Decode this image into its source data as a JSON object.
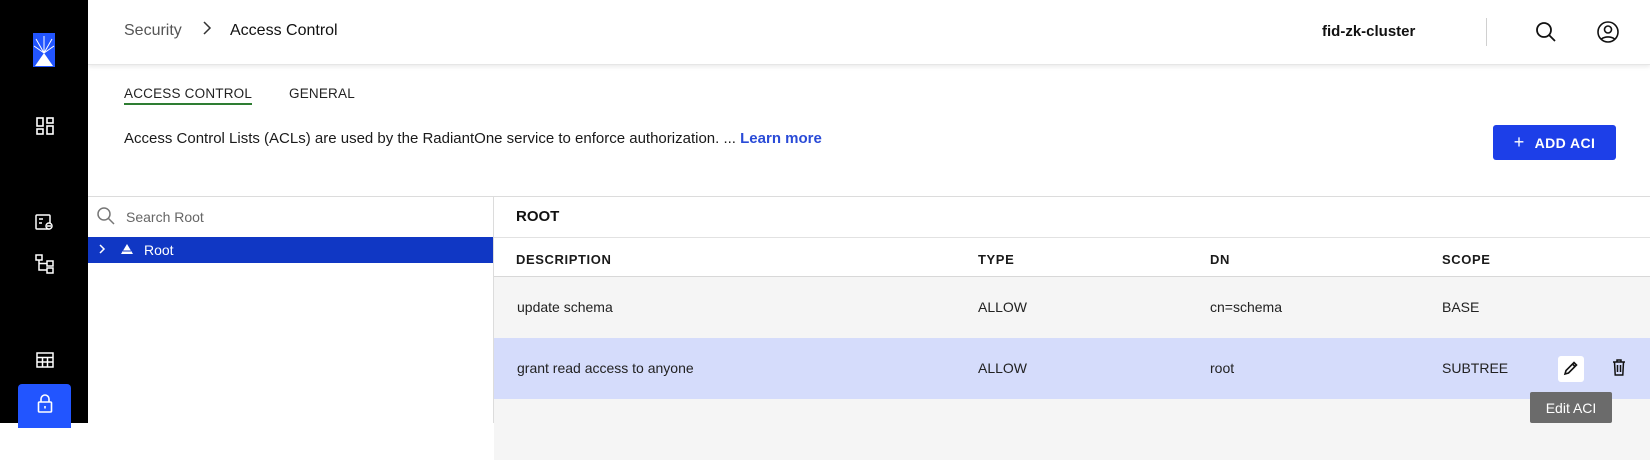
{
  "sidebar": {
    "logo": "radiantone-logo",
    "items": [
      {
        "icon": "dashboard-icon"
      },
      {
        "icon": "directory-link-icon"
      },
      {
        "icon": "hierarchy-icon"
      },
      {
        "icon": "table-grid-icon"
      },
      {
        "icon": "lock-icon",
        "active": true
      }
    ],
    "active_color": "#2255ff"
  },
  "header": {
    "breadcrumb": {
      "parent": "Security",
      "separator": ">",
      "current": "Access Control"
    },
    "cluster_name": "fid-zk-cluster",
    "icons": [
      "search-icon",
      "user-circle-icon"
    ]
  },
  "tabs": [
    {
      "label": "ACCESS CONTROL",
      "active": true
    },
    {
      "label": "GENERAL",
      "active": false
    }
  ],
  "description": {
    "text": "Access Control Lists (ACLs) are used by the RadiantOne service to enforce authorization. ... ",
    "learn_more": "Learn more"
  },
  "add_button": {
    "label": "ADD ACI",
    "icon": "plus-icon",
    "color": "#1d3fe8"
  },
  "tree": {
    "search_placeholder": "Search Root",
    "nodes": [
      {
        "label": "Root",
        "selected": true,
        "expandable": true
      }
    ],
    "selected_color": "#1037c4"
  },
  "content": {
    "title": "ROOT",
    "columns": [
      "DESCRIPTION",
      "TYPE",
      "DN",
      "SCOPE"
    ],
    "rows": [
      {
        "description": "update schema",
        "type": "ALLOW",
        "dn": "cn=schema",
        "scope": "BASE"
      },
      {
        "description": "grant read access to anyone",
        "type": "ALLOW",
        "dn": "root",
        "scope": "SUBTREE",
        "hovered": true
      }
    ],
    "row_actions": [
      "edit-icon",
      "trash-icon"
    ],
    "hover_color": "#d5dcfb"
  },
  "tooltip": {
    "text": "Edit ACI"
  }
}
